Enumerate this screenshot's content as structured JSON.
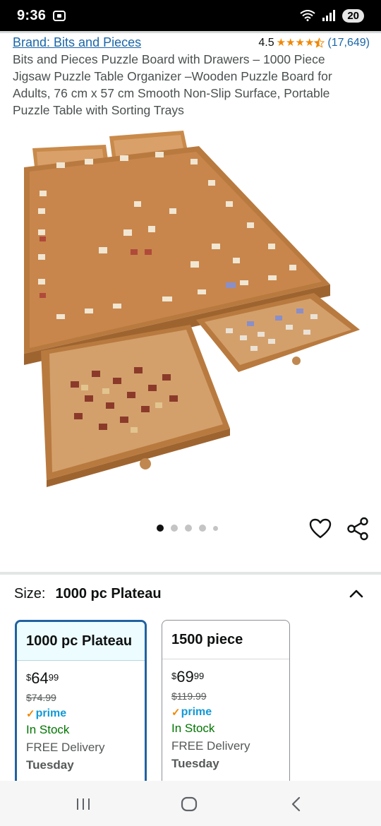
{
  "status_bar": {
    "time": "9:36",
    "battery": "20"
  },
  "product": {
    "brand": "Brand: Bits and Pieces",
    "rating": "4.5",
    "rating_count": "(17,649)",
    "title": "Bits and Pieces Puzzle Board with Drawers – 1000 Piece Jigsaw Puzzle Table Organizer –Wooden Puzzle Board for Adults, 76 cm x 57 cm Smooth Non-Slip Surface, Portable Puzzle Table with Sorting Trays",
    "image_count": 5,
    "active_image": 1
  },
  "size": {
    "label": "Size:",
    "selected": "1000 pc Plateau",
    "options": [
      {
        "name": "1000 pc Plateau",
        "currency": "$",
        "price_whole": "64",
        "price_fraction": "99",
        "list_price": "$74.99",
        "prime": "prime",
        "stock": "In Stock",
        "delivery": "FREE Delivery",
        "delivery_day": "Tuesday"
      },
      {
        "name": "1500 piece",
        "currency": "$",
        "price_whole": "69",
        "price_fraction": "99",
        "list_price": "$119.99",
        "prime": "prime",
        "stock": "In Stock",
        "delivery": "FREE Delivery",
        "delivery_day": "Tuesday"
      }
    ]
  },
  "colors": {
    "link": "#1a66a8",
    "star": "#f08804",
    "in_stock": "#007600",
    "prime": "#1399d6",
    "selected_border": "#2162a1"
  }
}
